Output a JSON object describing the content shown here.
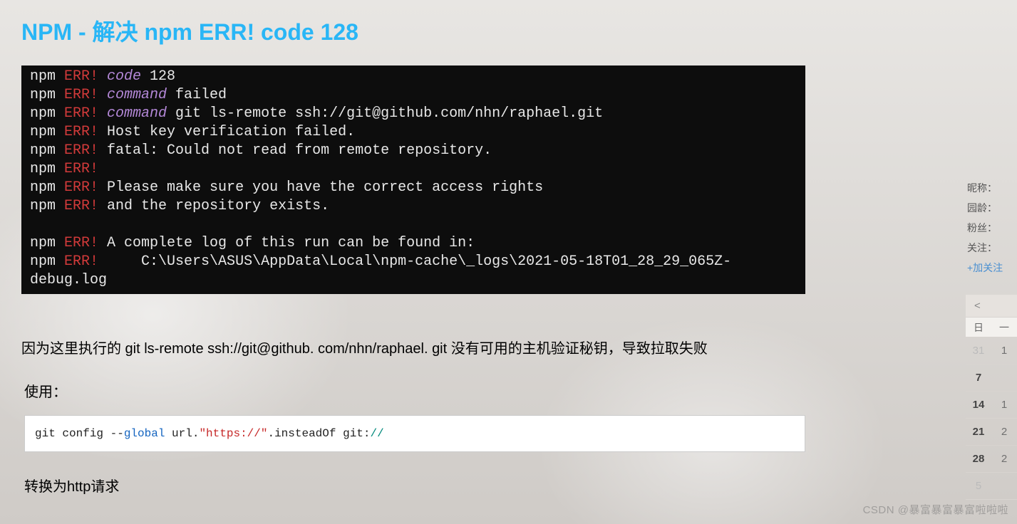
{
  "title": "NPM - 解决 npm ERR! code 128",
  "terminal": {
    "lines": [
      {
        "prefix": "npm ",
        "err": "ERR!",
        "cmd": " code",
        "text": " 128"
      },
      {
        "prefix": "npm ",
        "err": "ERR!",
        "cmd": " command",
        "text": " failed"
      },
      {
        "prefix": "npm ",
        "err": "ERR!",
        "cmd": " command",
        "text": " git ls-remote ssh://git@github.com/nhn/raphael.git"
      },
      {
        "prefix": "npm ",
        "err": "ERR!",
        "cmd": "",
        "text": " Host key verification failed."
      },
      {
        "prefix": "npm ",
        "err": "ERR!",
        "cmd": "",
        "text": " fatal: Could not read from remote repository."
      },
      {
        "prefix": "npm ",
        "err": "ERR!",
        "cmd": "",
        "text": ""
      },
      {
        "prefix": "npm ",
        "err": "ERR!",
        "cmd": "",
        "text": " Please make sure you have the correct access rights"
      },
      {
        "prefix": "npm ",
        "err": "ERR!",
        "cmd": "",
        "text": " and the repository exists."
      },
      {
        "prefix": "",
        "err": "",
        "cmd": "",
        "text": ""
      },
      {
        "prefix": "npm ",
        "err": "ERR!",
        "cmd": "",
        "text": " A complete log of this run can be found in:"
      },
      {
        "prefix": "npm ",
        "err": "ERR!",
        "cmd": "",
        "text": "     C:\\Users\\ASUS\\AppData\\Local\\npm-cache\\_logs\\2021-05-18T01_28_29_065Z-debug.log"
      }
    ]
  },
  "paragraph1": "因为这里执行的 git ls-remote ssh://git@github. com/nhn/raphael. git 没有可用的主机验证秘钥，导致拉取失败",
  "useLabel": "使用：",
  "code": {
    "p1": "git config --",
    "p2": "global",
    "p3": " url.",
    "p4": "\"https://\"",
    "p5": ".insteadOf git:",
    "p6": "//"
  },
  "paragraph2": "转换为http请求",
  "sidebar": {
    "nickname": "昵称：",
    "age": "园龄：",
    "fans": "粉丝：",
    "following": "关注：",
    "addFollow": "+加关注"
  },
  "calendar": {
    "nav": "<",
    "head": [
      "日",
      "一"
    ],
    "rows": [
      [
        "31",
        "1"
      ],
      [
        "7",
        ""
      ],
      [
        "14",
        "1"
      ],
      [
        "21",
        "2"
      ],
      [
        "28",
        "2"
      ],
      [
        "5",
        ""
      ]
    ]
  },
  "watermark": "CSDN @暴富暴富暴富啦啦啦"
}
